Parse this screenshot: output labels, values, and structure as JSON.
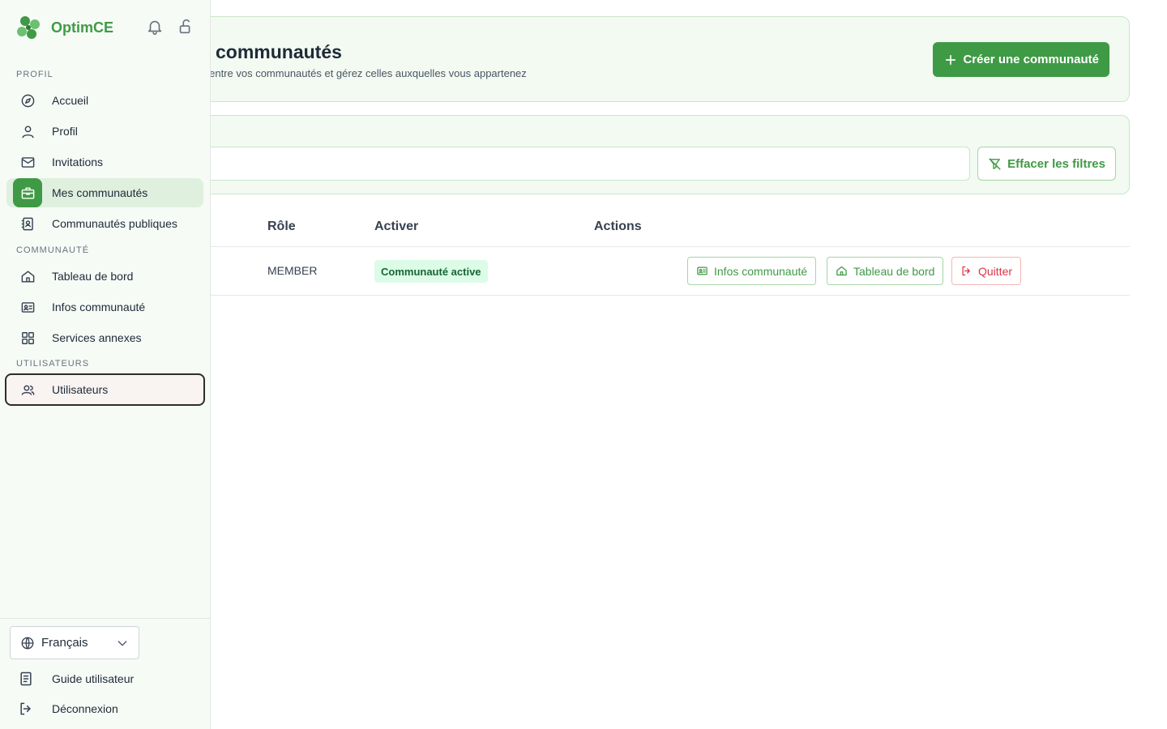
{
  "header": {
    "title": "communautés",
    "subtitle": "z entre vos communautés et gérez celles auxquelles vous appartenez",
    "create_button": "Créer une communauté"
  },
  "filters": {
    "clear_button": "Effacer les filtres"
  },
  "table": {
    "columns": [
      "Rôle",
      "Activer",
      "Actions"
    ],
    "rows": [
      {
        "role": "MEMBER",
        "status": "Communauté active",
        "actions": [
          "Infos communauté",
          "Tableau de bord",
          "Quitter"
        ]
      }
    ]
  },
  "sidebar": {
    "brand": "OptimCE",
    "sections": {
      "profil": "PROFIL",
      "communaute": "COMMUNAUTÉ",
      "utilisateurs": "UTILISATEURS"
    },
    "items": [
      {
        "label": "Accueil",
        "icon": "compass-icon"
      },
      {
        "label": "Profil",
        "icon": "user-icon"
      },
      {
        "label": "Invitations",
        "icon": "mail-icon"
      },
      {
        "label": "Mes communautés",
        "icon": "briefcase-icon",
        "active": true
      },
      {
        "label": "Communautés publiques",
        "icon": "contact-book-icon"
      },
      {
        "label": "Tableau de bord",
        "icon": "home-icon"
      },
      {
        "label": "Infos communauté",
        "icon": "id-card-icon"
      },
      {
        "label": "Services annexes",
        "icon": "grid-icon"
      },
      {
        "label": "Utilisateurs",
        "icon": "users-icon",
        "focused": true
      }
    ],
    "language": "Français",
    "guide": "Guide utilisateur",
    "logout": "Déconnexion"
  },
  "colors": {
    "accent": "#3f9a45",
    "danger": "#dc3545",
    "badge_bg": "#dcfce7",
    "sidebar_bg": "#f6fbf6"
  }
}
